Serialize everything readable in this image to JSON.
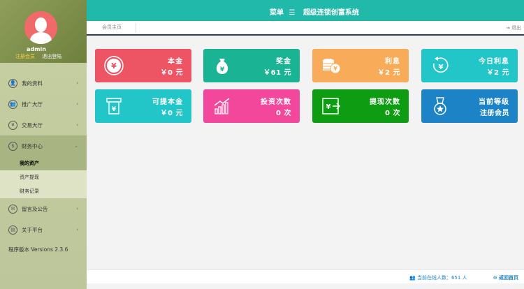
{
  "profile": {
    "username": "admin",
    "level": "注册会员",
    "logout": "退出登陆"
  },
  "sidebar": {
    "items": [
      {
        "label": "我的资料",
        "icon": "user-icon"
      },
      {
        "label": "推广大厅",
        "icon": "users-icon"
      },
      {
        "label": "交易大厅",
        "icon": "yen-icon"
      },
      {
        "label": "财务中心",
        "icon": "money-icon"
      },
      {
        "label": "留言及公告",
        "icon": "message-icon"
      },
      {
        "label": "关于平台",
        "icon": "book-icon"
      }
    ],
    "sub_items": [
      "我的资产",
      "资产提现",
      "财务记录"
    ],
    "version": "程序版本 Versions 2.3.6"
  },
  "header": {
    "menu_label": "菜单",
    "system_title": "超级连锁创富系统",
    "tab_label": "会员主页",
    "logout_label": "退出"
  },
  "cards": [
    {
      "title": "本金",
      "value": "￥0 元",
      "color": "#ed5565",
      "icon": "yen-circle-icon"
    },
    {
      "title": "奖金",
      "value": "￥61 元",
      "color": "#1ab394",
      "icon": "money-bag-icon"
    },
    {
      "title": "利息",
      "value": "￥2 元",
      "color": "#f8ac59",
      "icon": "coins-icon"
    },
    {
      "title": "今日利息",
      "value": "￥2 元",
      "color": "#23c6c8",
      "icon": "yen-refresh-icon"
    },
    {
      "title": "可提本金",
      "value": "￥0 元",
      "color": "#23c6c8",
      "icon": "atm-icon"
    },
    {
      "title": "投资次数",
      "value": "0 次",
      "color": "#f2479b",
      "icon": "growth-chart-icon"
    },
    {
      "title": "提现次数",
      "value": "0 次",
      "color": "#0e9d12",
      "icon": "withdraw-icon"
    },
    {
      "title": "当前等级",
      "value": "注册会员",
      "color": "#1c84c6",
      "icon": "medal-icon"
    }
  ],
  "footer": {
    "online_text": "当前在线人数：651 人",
    "home_label": "返回首页"
  }
}
